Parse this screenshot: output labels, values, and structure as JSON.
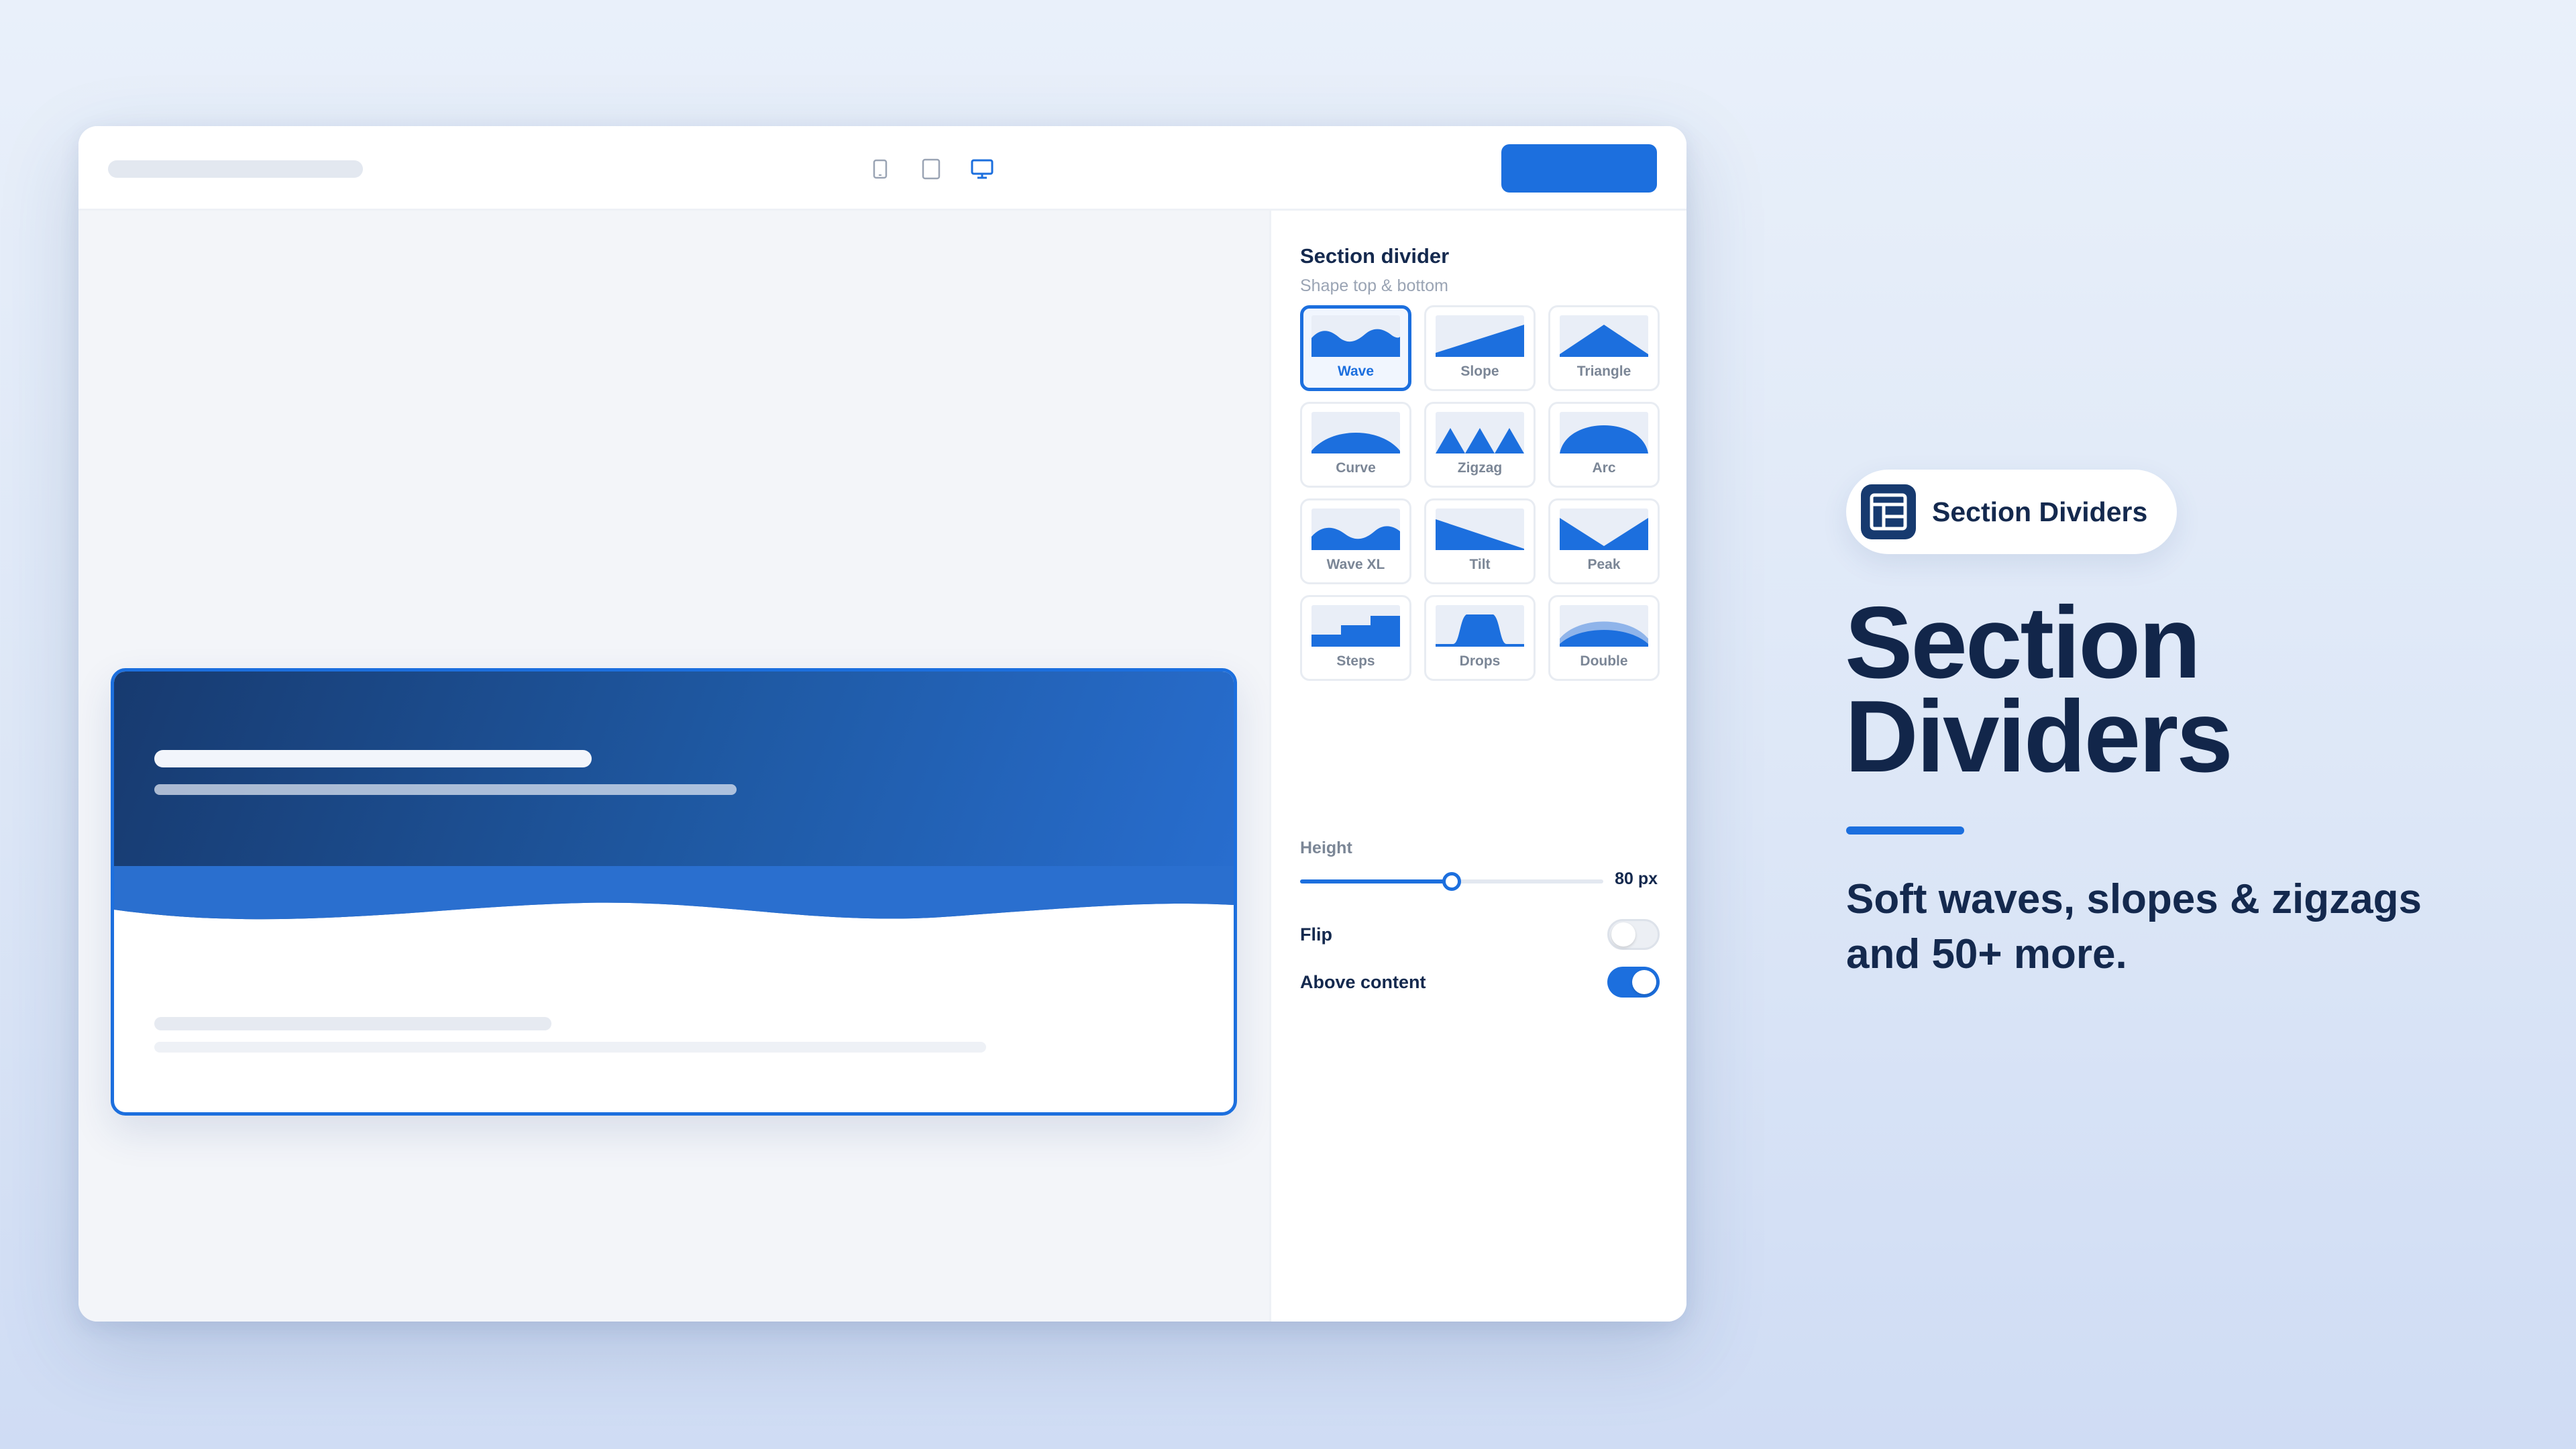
{
  "panel": {
    "title": "Section divider",
    "subtitle": "Shape top & bottom",
    "shapes": [
      {
        "label": "Wave",
        "icon": "wave-shape-icon",
        "selected": true
      },
      {
        "label": "Slope",
        "icon": "slope-shape-icon"
      },
      {
        "label": "Triangle",
        "icon": "triangle-shape-icon"
      },
      {
        "label": "Curve",
        "icon": "curve-shape-icon"
      },
      {
        "label": "Zigzag",
        "icon": "zigzag-shape-icon"
      },
      {
        "label": "Arc",
        "icon": "arc-shape-icon"
      },
      {
        "label": "Wave XL",
        "icon": "wave-xl-shape-icon"
      },
      {
        "label": "Tilt",
        "icon": "tilt-shape-icon"
      },
      {
        "label": "Peak",
        "icon": "peak-shape-icon"
      },
      {
        "label": "Steps",
        "icon": "steps-shape-icon"
      },
      {
        "label": "Drops",
        "icon": "drops-shape-icon"
      },
      {
        "label": "Double",
        "icon": "double-shape-icon"
      }
    ],
    "height_label": "Height",
    "height_value": "80 px",
    "height_fraction": 0.5,
    "flip_label": "Flip",
    "flip_on": false,
    "above_label": "Above content",
    "above_on": true
  },
  "toolbar": {
    "devices": [
      "mobile-icon",
      "tablet-icon",
      "desktop-icon"
    ],
    "active_device": "desktop-icon"
  },
  "colors": {
    "accent": "#1c6fde",
    "navy": "#173a6f",
    "text": "#14294e"
  },
  "badge": {
    "label": "Section Dividers",
    "icon": "layout-sections-icon"
  },
  "headline": {
    "line1": "Section",
    "line2": "Dividers"
  },
  "tagline": {
    "line1": "Soft waves, slopes & zigzags",
    "line2": "and 50+ more."
  }
}
